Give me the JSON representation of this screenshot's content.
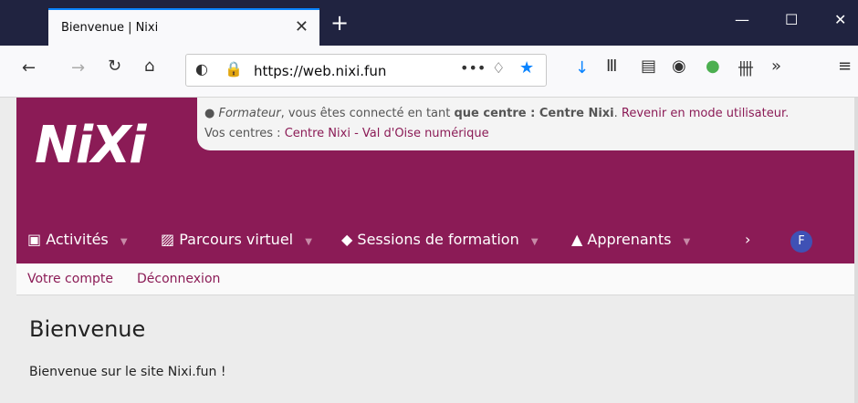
{
  "browser": {
    "tab_title": "Bienvenue | Nixi",
    "url": "https://web.nixi.fun"
  },
  "notice": {
    "role": "Formateur",
    "line1_middle": ", vous êtes connecté en tant ",
    "strong": "que centre : Centre Nixi",
    "line1_end": ". ",
    "switch_link": "Revenir en mode utilisateur.",
    "line2_label": "Vos centres : ",
    "center_link": "Centre Nixi - Val d'Oise numérique"
  },
  "logo": {
    "text": "NiXi"
  },
  "menu": {
    "items": [
      {
        "label": "Activités"
      },
      {
        "label": "Parcours virtuel"
      },
      {
        "label": "Sessions de formation"
      },
      {
        "label": "Apprenants"
      }
    ],
    "avatar": "F"
  },
  "subnav": {
    "account": "Votre compte",
    "logout": "Déconnexion"
  },
  "content": {
    "title": "Bienvenue",
    "text": "Bienvenue sur le site Nixi.fun !"
  }
}
